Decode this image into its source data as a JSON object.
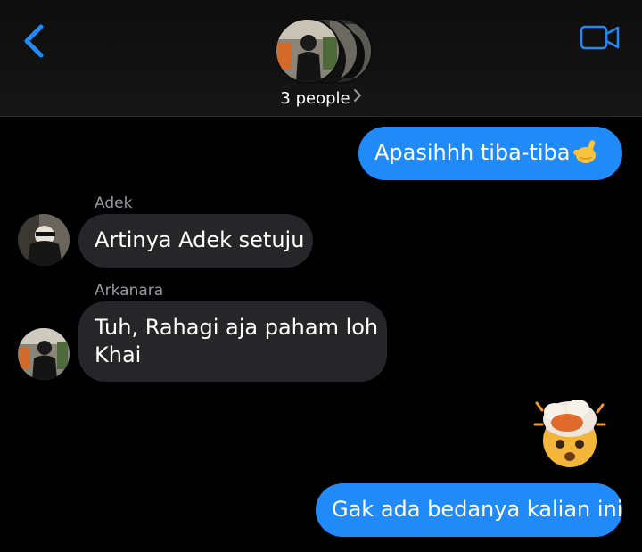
{
  "header": {
    "people_label": "3 people",
    "icons": {
      "back": "chevron-left-icon",
      "video": "video-camera-icon",
      "disclosure": "chevron-right-icon"
    }
  },
  "colors": {
    "accent": "#1f8af8",
    "incoming_bubble": "#262628",
    "background": "#000000",
    "sender_name": "#9a9a9e"
  },
  "messages": [
    {
      "direction": "outgoing",
      "text": "Apasihhh tiba-tiba",
      "emoji": "call-me-hand"
    },
    {
      "direction": "incoming",
      "sender": "Adek",
      "text": "Artinya Adek setuju"
    },
    {
      "direction": "incoming",
      "sender": "Arkanara",
      "line1": "Tuh, Rahagi aja paham loh",
      "line2": "Khai"
    },
    {
      "direction": "outgoing",
      "emoji": "exploding-head"
    },
    {
      "direction": "outgoing",
      "text": "Gak ada bedanya kalian ini"
    }
  ]
}
